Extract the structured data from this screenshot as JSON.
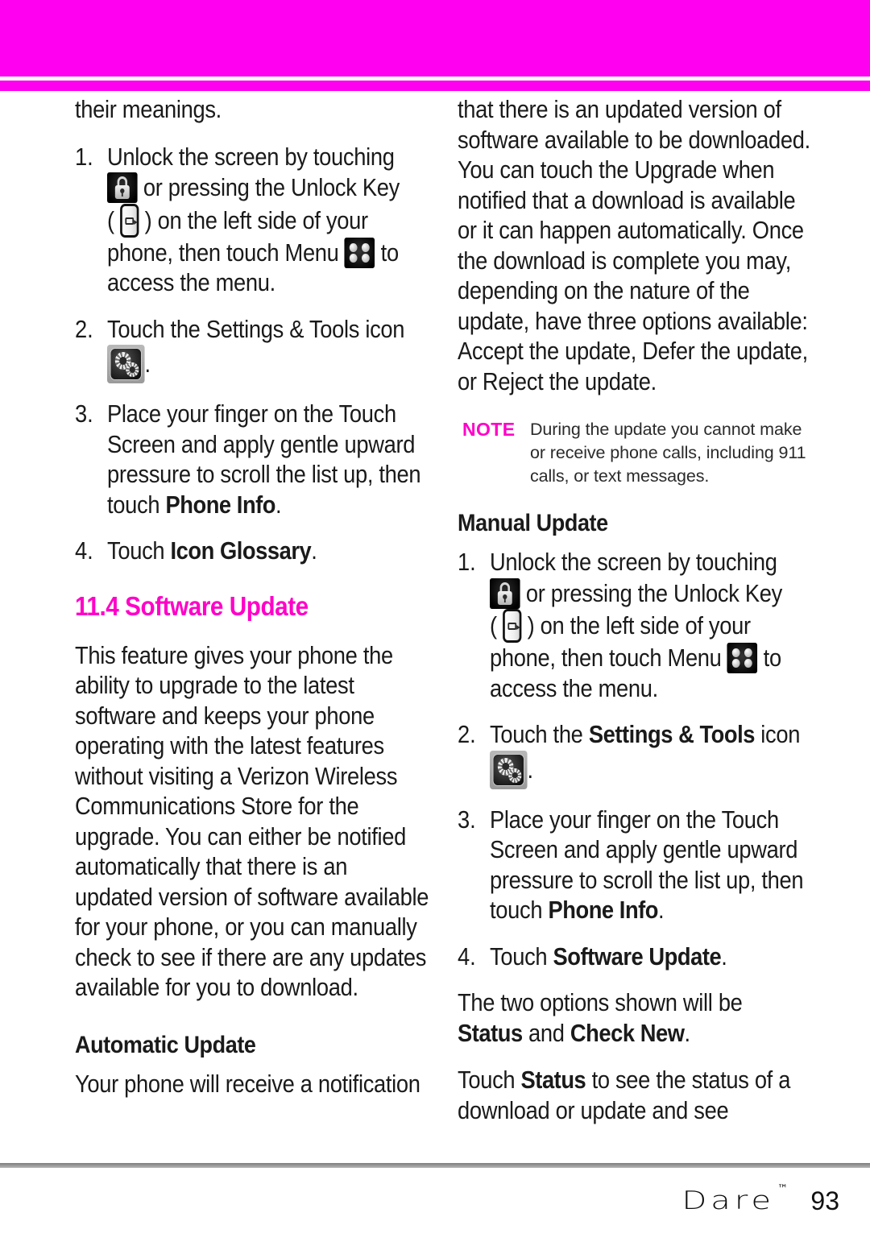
{
  "colors": {
    "accent_magenta": "#FF00F0",
    "heading_magenta": "#FF00C8",
    "body_text": "#1a1a1a",
    "footer_rule": "#8a8a8a"
  },
  "left_column": {
    "continued_line": "their meanings.",
    "steps": [
      {
        "num": "1.",
        "parts": [
          {
            "type": "text",
            "value": "Unlock the screen by touching "
          },
          {
            "type": "icon",
            "value": "lock-icon"
          },
          {
            "type": "text",
            "value": " or pressing the Unlock Key ( "
          },
          {
            "type": "icon",
            "value": "unlock-key-icon"
          },
          {
            "type": "text",
            "value": " ) on the left side of your phone, then touch Menu "
          },
          {
            "type": "icon",
            "value": "menu-grid-icon"
          },
          {
            "type": "text",
            "value": " to access the menu."
          }
        ],
        "text_1": "Unlock the screen by touching",
        "text_2": "or pressing the Unlock Key",
        "text_3": ") on the left side of your",
        "text_4": "phone, then touch Menu",
        "text_5": "to",
        "text_6": "access the menu.",
        "paren_open": "("
      },
      {
        "num": "2.",
        "text_1": "Touch the Settings & Tools icon",
        "text_2": "."
      },
      {
        "num": "3.",
        "text_1": "Place your finger on the Touch Screen and apply gentle upward pressure to scroll the list up, then touch ",
        "bold": "Phone Info",
        "text_2": "."
      },
      {
        "num": "4.",
        "text_1": "Touch ",
        "bold": "Icon Glossary",
        "text_2": "."
      }
    ],
    "section_heading": "11.4 Software Update",
    "intro_paragraph": "This feature gives your phone the ability to upgrade to the latest software and keeps your phone operating with the latest features without visiting a Verizon Wireless Communications Store for the upgrade. You can either be notified automatically that there is an updated version of software available for your phone, or you can manually check to see if there are any updates available for you to download.",
    "automatic_update_heading": "Automatic Update",
    "automatic_update_paragraph": "Your phone will receive a notification"
  },
  "right_column": {
    "continued_paragraph": "that there is an updated version of software available to be downloaded. You can touch the Upgrade when notified that a download is available or it can happen automatically. Once the download is complete you may, depending on the nature of the update, have three options available: Accept the update, Defer the update, or Reject the update.",
    "note": {
      "label": "NOTE",
      "body": "During the update you cannot make or receive phone calls, including 911 calls, or text messages."
    },
    "manual_update_heading": "Manual Update",
    "steps": [
      {
        "num": "1.",
        "text_1": "Unlock the screen by touching",
        "text_2": "or pressing the Unlock Key",
        "paren_open": "(",
        "text_3": ") on the left side of your",
        "text_4": "phone, then touch Menu",
        "text_5": "to",
        "text_6": "access the menu."
      },
      {
        "num": "2.",
        "text_1": "Touch the ",
        "bold": "Settings & Tools",
        "text_2": " icon",
        "text_3": "."
      },
      {
        "num": "3.",
        "text_1": "Place your finger on the Touch Screen and apply gentle upward pressure to scroll the list up, then touch ",
        "bold": "Phone Info",
        "text_2": "."
      },
      {
        "num": "4.",
        "text_1": "Touch ",
        "bold": "Software Update",
        "text_2": "."
      }
    ],
    "options_paragraph_1a": "The two options shown will be ",
    "options_bold_1": "Status",
    "options_paragraph_1b": " and ",
    "options_bold_2": "Check New",
    "options_paragraph_1c": ".",
    "options_paragraph_2a": "Touch ",
    "options_bold_3": "Status",
    "options_paragraph_2b": " to see the status of a download or update and see"
  },
  "footer": {
    "brand": "Dare",
    "trademark": "™",
    "page_number": "93"
  }
}
